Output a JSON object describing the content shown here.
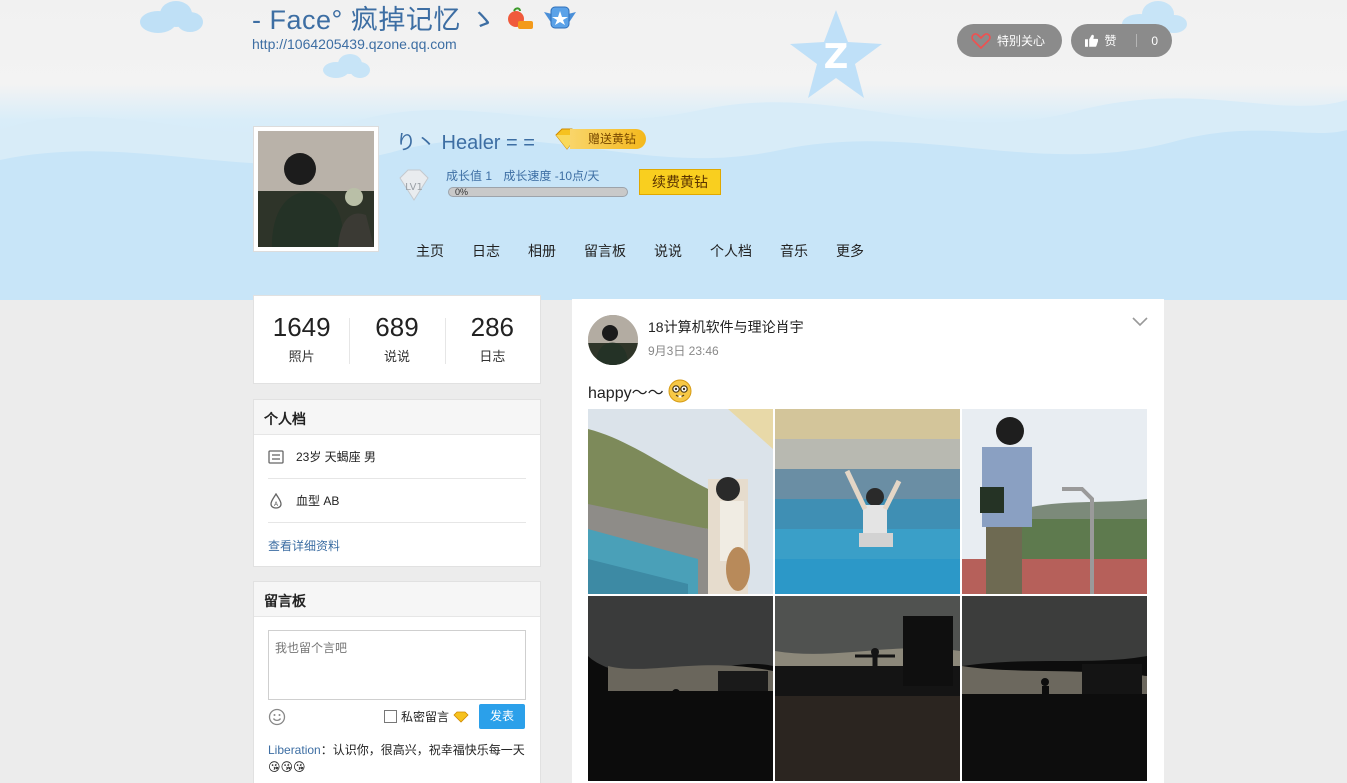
{
  "header": {
    "site_title": "- Face° 疯掉记忆 ゝ",
    "site_url": "http://1064205439.qzone.qq.com",
    "special_care_label": "特别关心",
    "like_label": "赞",
    "like_count": "0"
  },
  "profile": {
    "nickname": "り丶 Healer = =",
    "gift_vip_label": "赠送黄钻",
    "level_badge": "LV1",
    "growth_value": "成长值 1",
    "growth_speed": "成长速度 -10点/天",
    "progress_percent": "0%",
    "progress_fraction": 0,
    "renew_label": "续费黄钻"
  },
  "nav": {
    "items": [
      "主页",
      "日志",
      "相册",
      "留言板",
      "说说",
      "个人档",
      "音乐",
      "更多"
    ]
  },
  "stats": [
    {
      "num": "1649",
      "label": "照片"
    },
    {
      "num": "689",
      "label": "说说"
    },
    {
      "num": "286",
      "label": "日志"
    }
  ],
  "profile_card": {
    "title": "个人档",
    "basic": "23岁  天蝎座 男",
    "blood": "血型 AB",
    "detail_link": "查看详细资料"
  },
  "message_board": {
    "title": "留言板",
    "placeholder": "我也留个言吧",
    "private_label": "私密留言",
    "send_label": "发表",
    "entry_author": "Liberation",
    "entry_text": "：认识你，很高兴，祝幸福快乐每一天😘😘😘"
  },
  "feed": {
    "author": "18计算机软件与理论肖宇",
    "time": "9月3日 23:46",
    "text": "happy～～",
    "emoji": "nerd-face-emoji"
  },
  "colors": {
    "link_blue": "#3d6ea3",
    "send_blue": "#2ba0ea",
    "vip_gold": "#f9cf1f"
  }
}
